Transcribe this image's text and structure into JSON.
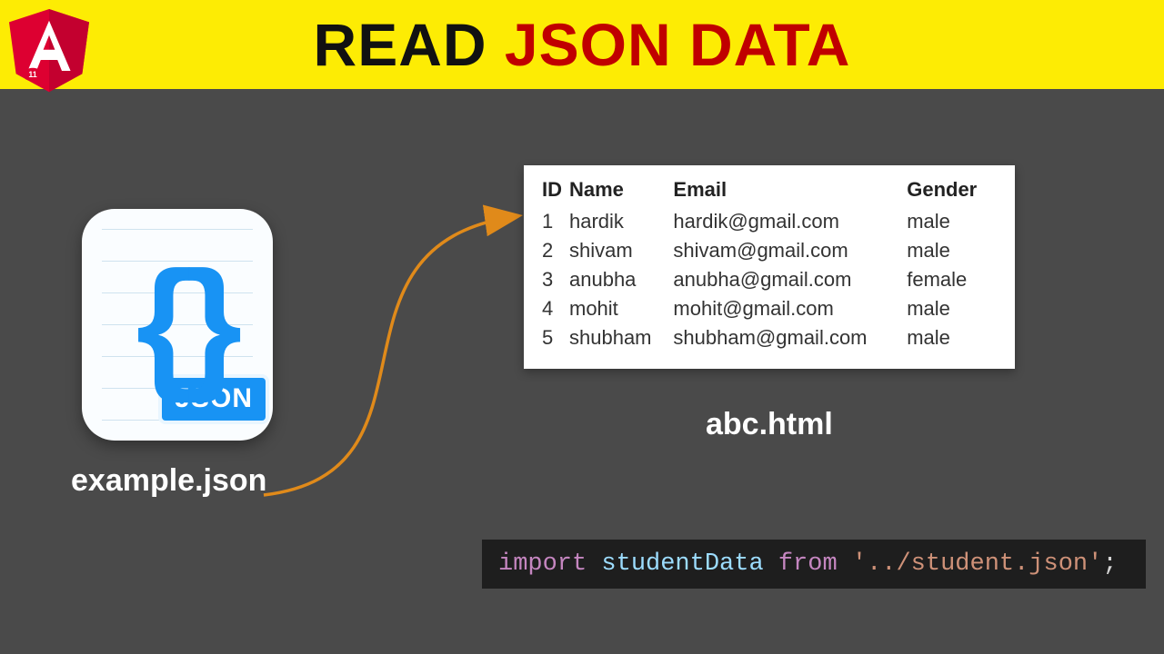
{
  "banner": {
    "logo_version": "11",
    "title_part1": "READ ",
    "title_part2": "JSON DATA"
  },
  "source_file": {
    "badge": "JSON",
    "label": "example.json"
  },
  "output_file": {
    "label": "abc.html"
  },
  "table": {
    "headers": {
      "id": "ID",
      "name": "Name",
      "email": "Email",
      "gender": "Gender"
    },
    "rows": [
      {
        "id": "1",
        "name": "hardik",
        "email": "hardik@gmail.com",
        "gender": "male"
      },
      {
        "id": "2",
        "name": "shivam",
        "email": "shivam@gmail.com",
        "gender": "male"
      },
      {
        "id": "3",
        "name": "anubha",
        "email": "anubha@gmail.com",
        "gender": "female"
      },
      {
        "id": "4",
        "name": "mohit",
        "email": "mohit@gmail.com",
        "gender": "male"
      },
      {
        "id": "5",
        "name": "shubham",
        "email": "shubham@gmail.com",
        "gender": "male"
      }
    ]
  },
  "code": {
    "kw_import": "import",
    "ident": "studentData",
    "kw_from": "from",
    "string": "'../student.json'",
    "semicolon": ";"
  }
}
